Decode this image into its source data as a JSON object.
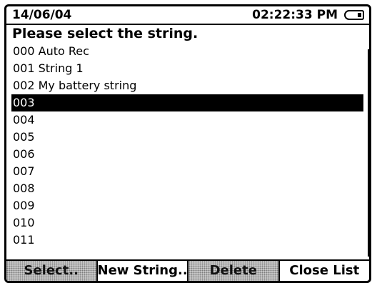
{
  "status_bar": {
    "date": "14/06/04",
    "time": "02:22:33 PM",
    "battery_icon": "battery-icon"
  },
  "prompt": "Please select the string.",
  "strings": [
    "000 Auto Rec",
    "001 String 1",
    "002 My battery string",
    "003",
    "004",
    "005",
    "006",
    "007",
    "008",
    "009",
    "010",
    "011"
  ],
  "selected_string": "003",
  "buttons": {
    "select": "Select..",
    "new_string": "New String..",
    "delete": "Delete",
    "close_list": "Close List"
  },
  "colors": {
    "background": "#ffffff",
    "foreground": "#000000",
    "disabled_fill": "#d0d0d0"
  }
}
